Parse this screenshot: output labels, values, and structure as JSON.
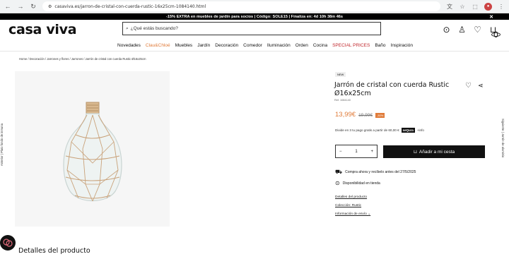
{
  "browser": {
    "url": "casaviva.es/jarron-de-cristal-con-cuerda-rustic-16x25cm-1084140.html"
  },
  "promo": {
    "text": "-15% EXTRA en muebles de jardín para socios | Código: SOLE15 | Finaliza en: 4d 10h 38m 46s",
    "close": "✕"
  },
  "header": {
    "logo": "casa viva",
    "search_placeholder": "¿Qué estás buscando?",
    "cart_count": "0"
  },
  "menu": {
    "items": [
      "Novedades",
      "Clau&Chloé",
      "Muebles",
      "Jardín",
      "Decoración",
      "Comedor",
      "Iluminación",
      "Orden",
      "Cocina",
      "SPECIAL PRICES",
      "Baño",
      "Inspiración"
    ]
  },
  "breadcrumb": "Home  /  Decoración  /  Jarrones y flores  /  Jarrones  /  Jarrón de cristal con cuerda Rustic Ø16x25cm",
  "side": {
    "left": "Anterior  |  Plato fondo de inmuna",
    "right": "Siguiente  |  Jarrón de aluminio"
  },
  "product": {
    "badge": "NEW",
    "title": "Jarrón de cristal con cuerda Rustic Ø16x25cm",
    "ref": "Ref. 1084140",
    "price": "13,99€",
    "old_price": "19,99€",
    "discount": "-30%",
    "pay_text": "Divide en 3 tu pago gratis a partir de 60,00 €",
    "pay_brand": "seQura",
    "pay_more": "+info",
    "qty": "1",
    "qty_minus": "−",
    "qty_plus": "+",
    "add_label": "Añadir a mi cesta",
    "shipping": "Compra ahora y recíbelo antes del 27/5/2025",
    "store": "Disponibilidad en tienda",
    "link1": "Detalles del producto",
    "link2": "Colección: Rustic",
    "link3": "Información de envío ⌄"
  },
  "details_title": "Detalles del producto",
  "colors": {
    "accent": "#e07b39",
    "dark": "#111111"
  }
}
